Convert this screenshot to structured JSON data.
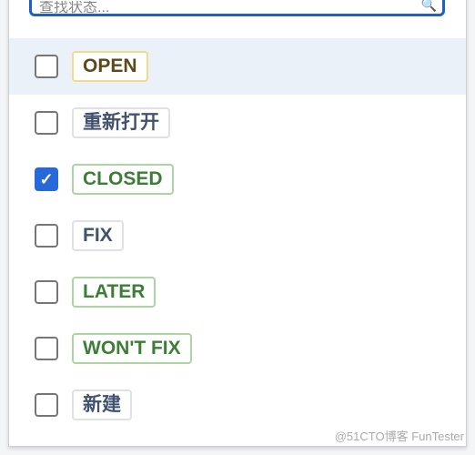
{
  "search": {
    "placeholder": "查找状态..."
  },
  "options": [
    {
      "label": "OPEN",
      "checked": false,
      "color": "#594a1a",
      "border": "#f5d98c"
    },
    {
      "label": "重新打开",
      "checked": false,
      "color": "#42526e",
      "border": "#dfe1e6"
    },
    {
      "label": "CLOSED",
      "checked": true,
      "color": "#3d7e37",
      "border": "#abd5a3"
    },
    {
      "label": "FIX",
      "checked": false,
      "color": "#42526e",
      "border": "#dfe1e6"
    },
    {
      "label": "LATER",
      "checked": false,
      "color": "#3d7e37",
      "border": "#abd5a3"
    },
    {
      "label": "WON'T FIX",
      "checked": false,
      "color": "#3d7e37",
      "border": "#abd5a3"
    },
    {
      "label": "新建",
      "checked": false,
      "color": "#42526e",
      "border": "#dfe1e6"
    }
  ],
  "watermark": "@51CTO博客 FunTester"
}
